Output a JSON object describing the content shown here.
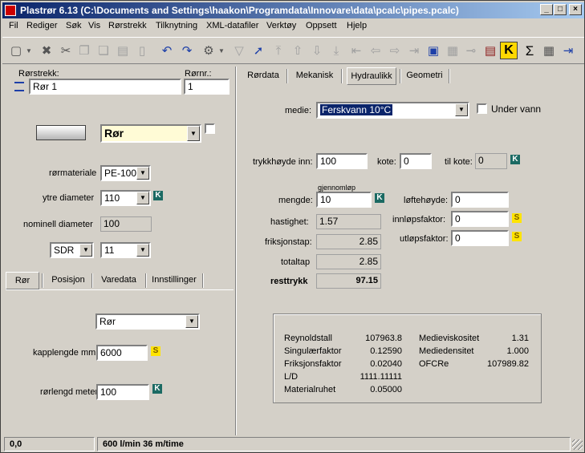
{
  "window": {
    "title": "Plastrør 6.13  (C:\\Documents and Settings\\haakon\\Programdata\\Innovare\\data\\pcalc\\pipes.pcalc)",
    "minimize": "_",
    "maximize": "□",
    "close": "×"
  },
  "menu": [
    "Fil",
    "Rediger",
    "Søk",
    "Vis",
    "Rørstrekk",
    "Tilknytning",
    "XML-datafiler",
    "Verktøy",
    "Oppsett",
    "Hjelp"
  ],
  "toolbar": {
    "k_label": "K",
    "sigma_label": "Σ"
  },
  "left": {
    "rorstrekk_label": "Rørstrekk:",
    "rorstrekk_value": "Rør 1",
    "rornr_label": "Rørnr.:",
    "rornr_value": "1",
    "type_select": "Rør",
    "rormateriale_label": "rørmateriale",
    "rormateriale_value": "PE-100",
    "ytre_diameter_label": "ytre diameter",
    "ytre_diameter_value": "110",
    "nominell_label": "nominell diameter",
    "nominell_value": "100",
    "sdr_select": "SDR",
    "sdr_value": "11",
    "tabs": [
      "Rør",
      "Posisjon",
      "Varedata",
      "Innstillinger"
    ],
    "sub_select": "Rør",
    "kapplengde_label": "kapplengde mm:",
    "kapplengde_value": "6000",
    "rorlengd_label": "rørlengd meter:",
    "rorlengd_value": "100"
  },
  "right": {
    "tabs": [
      "Rørdata",
      "Mekanisk",
      "Hydraulikk",
      "Geometri"
    ],
    "medie_label": "medie:",
    "medie_value": "Ferskvann 10°C",
    "under_vann_label": "Under vann",
    "trykkhoyde_label": "trykkhøyde inn:",
    "trykkhoyde_value": "100",
    "kote_label": "kote:",
    "kote_value": "0",
    "til_kote_label": "til kote:",
    "til_kote_value": "0",
    "gjennomlop_label": "gjennomløp",
    "mengde_label": "mengde:",
    "mengde_value": "10",
    "hastighet_label": "hastighet:",
    "hastighet_value": "1.57",
    "friksjonstap_label": "friksjonstap:",
    "friksjonstap_value": "2.85",
    "totaltap_label": "totaltap",
    "totaltap_value": "2.85",
    "resttrykk_label": "resttrykk",
    "resttrykk_value": "97.15",
    "lofthoyde_label": "løftehøyde:",
    "lofthoyde_value": "0",
    "innlopsfaktor_label": "innløpsfaktor:",
    "innlopsfaktor_value": "0",
    "utlopsfaktor_label": "utløpsfaktor:",
    "utlopsfaktor_value": "0",
    "info": {
      "reynoldstall_label": "Reynoldstall",
      "reynoldstall_value": "107963.8",
      "singulaer_label": "Singulærfaktor",
      "singulaer_value": "0.12590",
      "friksjon_label": "Friksjonsfaktor",
      "friksjon_value": "0.02040",
      "ld_label": "L/D",
      "ld_value": "1111.11111",
      "materialruhet_label": "Materialruhet",
      "materialruhet_value": "0.05000",
      "medieviskositet_label": "Medieviskositet",
      "medieviskositet_value": "1.31",
      "mediedensitet_label": "Mediedensitet",
      "mediedensitet_value": "1.000",
      "ofcre_label": "OFCRe",
      "ofcre_value": "107989.82"
    }
  },
  "status": {
    "coords": "0,0",
    "flow": "600 l/min   36 m/time"
  },
  "icons": {
    "k": "K",
    "s": "S",
    "dropdown": "▼"
  }
}
